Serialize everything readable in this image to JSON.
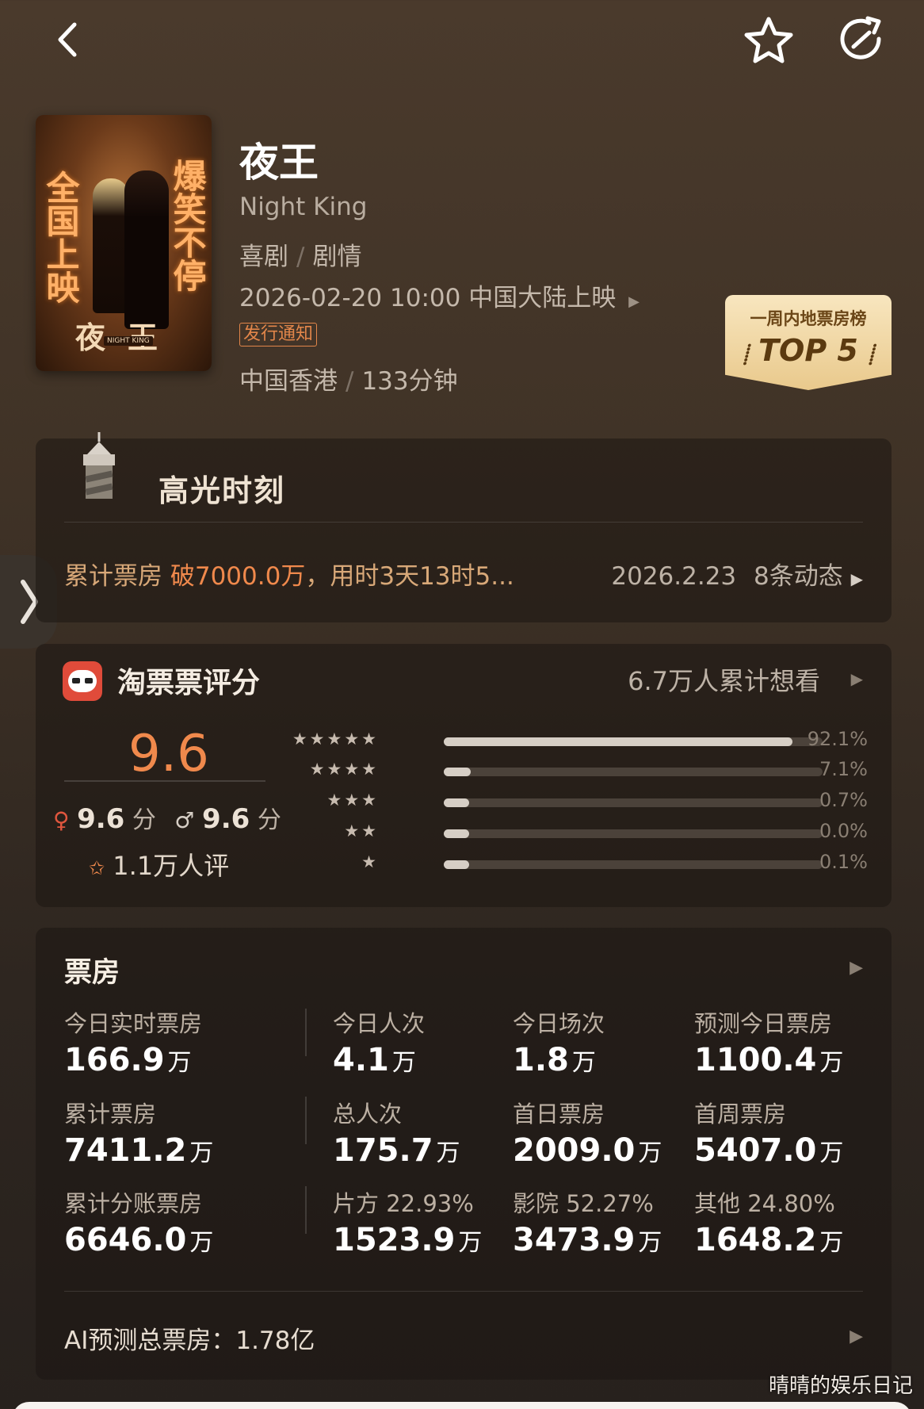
{
  "nav": {
    "back_icon": "chevron-left-icon",
    "favorite_icon": "star-outline-icon",
    "share_icon": "share-arrow-icon"
  },
  "poster": {
    "left_text": "全国上映",
    "right_text": "爆笑不停",
    "title_text": "夜王",
    "badge_text": "NIGHT KING"
  },
  "movie": {
    "title": "夜王",
    "english_title": "Night King",
    "genre_1": "喜剧",
    "genre_2": "剧情",
    "release": "2026-02-20 10:00 中国大陆上映",
    "notice_tag": "发行通知",
    "region": "中国香港",
    "duration": "133分钟"
  },
  "rank_badge": {
    "line1": "一周内地票房榜",
    "line2": "TOP 5"
  },
  "highlight": {
    "title": "高光时刻",
    "text_prefix": "累计票房 ",
    "text_hot": "破7000.0万",
    "text_suffix": "，用时3天13时5...",
    "date": "2026.2.23",
    "updates": "8条动态"
  },
  "rating": {
    "title": "淘票票评分",
    "want_to_see": "6.7万人累计想看",
    "score": "9.6",
    "female_score": "9.6",
    "male_score": "9.6",
    "score_unit": "分",
    "rater_count": "1.1万人评",
    "distribution": [
      {
        "stars": "★★★★★",
        "percent": 92.1,
        "label": "92.1%"
      },
      {
        "stars": "★★★★",
        "percent": 7.1,
        "label": "7.1%"
      },
      {
        "stars": "★★★",
        "percent": 0.7,
        "label": "0.7%"
      },
      {
        "stars": "★★",
        "percent": 0.0,
        "label": "0.0%"
      },
      {
        "stars": "★",
        "percent": 0.1,
        "label": "0.1%"
      }
    ]
  },
  "box_office": {
    "title": "票房",
    "unit": "万",
    "rows": [
      [
        {
          "label": "今日实时票房",
          "value": "166.9"
        },
        {
          "label": "今日人次",
          "value": "4.1"
        },
        {
          "label": "今日场次",
          "value": "1.8"
        },
        {
          "label": "预测今日票房",
          "value": "1100.4"
        }
      ],
      [
        {
          "label": "累计票房",
          "value": "7411.2"
        },
        {
          "label": "总人次",
          "value": "175.7"
        },
        {
          "label": "首日票房",
          "value": "2009.0"
        },
        {
          "label": "首周票房",
          "value": "5407.0"
        }
      ],
      [
        {
          "label": "累计分账票房",
          "value": "6646.0"
        },
        {
          "label": "片方 22.93%",
          "value": "1523.9"
        },
        {
          "label": "影院 52.27%",
          "value": "3473.9"
        },
        {
          "label": "其他 24.80%",
          "value": "1648.2"
        }
      ]
    ],
    "ai_forecast_label": "AI预测总票房：",
    "ai_forecast_value": "1.78亿"
  },
  "watermark": "晴晴的娱乐日记",
  "colors": {
    "accent": "#f0894c",
    "gold": "#e9c98c"
  }
}
